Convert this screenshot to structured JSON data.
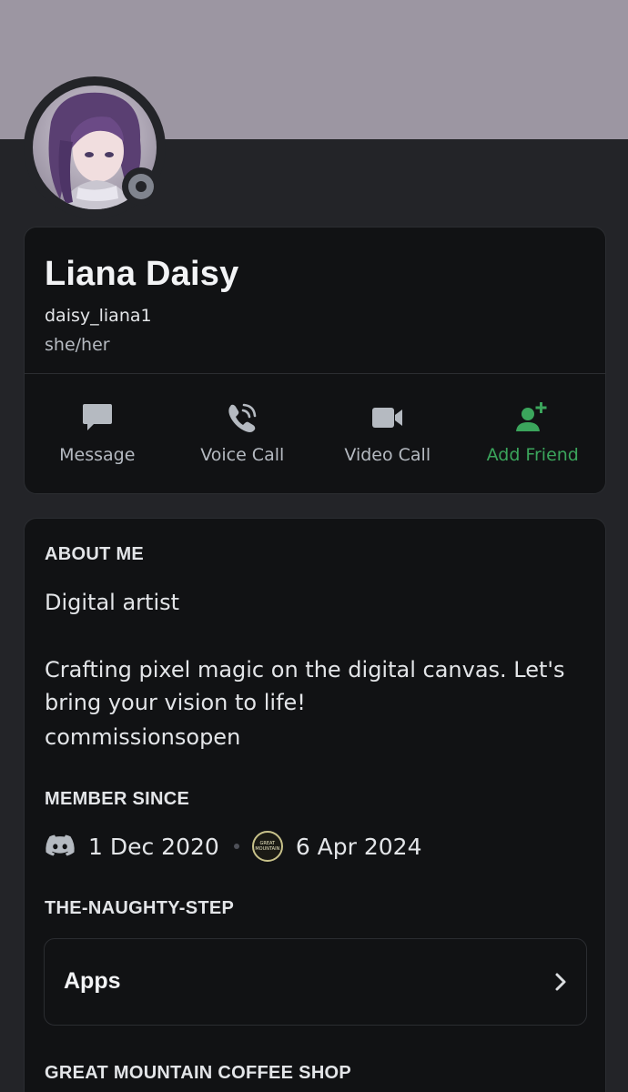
{
  "profile": {
    "display_name": "Liana Daisy",
    "username": "daisy_liana1",
    "pronouns": "she/her",
    "status": "offline",
    "banner_color": "#9c96a2"
  },
  "actions": [
    {
      "label": "Message",
      "icon": "chat-bubble-icon"
    },
    {
      "label": "Voice Call",
      "icon": "phone-icon"
    },
    {
      "label": "Video Call",
      "icon": "video-camera-icon"
    },
    {
      "label": "Add Friend",
      "icon": "add-friend-icon",
      "color": "#3ba55c"
    }
  ],
  "about": {
    "heading": "ABOUT ME",
    "line1": "Digital artist",
    "line2": "Crafting pixel magic on the digital canvas. Let's bring your vision to life!",
    "line3": "commissionsopen"
  },
  "member_since": {
    "heading": "MEMBER SINCE",
    "discord_date": "1 Dec 2020",
    "server_date": "6 Apr 2024",
    "server_badge_text": "GREAT MOUNTAIN"
  },
  "roles_section": {
    "heading": "THE-NAUGHTY-STEP",
    "apps_label": "Apps"
  },
  "next_section": {
    "heading": "GREAT MOUNTAIN COFFEE SHOP"
  }
}
